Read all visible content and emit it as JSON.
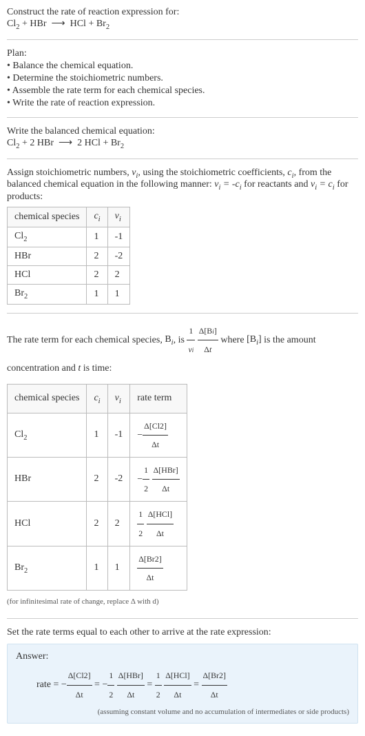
{
  "intro": {
    "line1": "Construct the rate of reaction expression for:",
    "arrow": "⟶"
  },
  "plan": {
    "title": "Plan:",
    "items": [
      "• Balance the chemical equation.",
      "• Determine the stoichiometric numbers.",
      "• Assemble the rate term for each chemical species.",
      "• Write the rate of reaction expression."
    ]
  },
  "balanced": {
    "title": "Write the balanced chemical equation:"
  },
  "stoich": {
    "text1": "Assign stoichiometric numbers, ",
    "text2": ", using the stoichiometric coefficients, ",
    "text3": ", from the balanced chemical equation in the following manner: ",
    "text4": " for reactants and ",
    "text5": " for products:",
    "headers": {
      "species": "chemical species",
      "ci": "cᵢ",
      "vi": "νᵢ"
    },
    "rows": [
      {
        "sp": "Cl₂",
        "ci": "1",
        "vi": "-1"
      },
      {
        "sp": "HBr",
        "ci": "2",
        "vi": "-2"
      },
      {
        "sp": "HCl",
        "ci": "2",
        "vi": "2"
      },
      {
        "sp": "Br₂",
        "ci": "1",
        "vi": "1"
      }
    ]
  },
  "rateterm": {
    "text1": "The rate term for each chemical species, ",
    "text2": ", is ",
    "text3": " where ",
    "text4": " is the amount concentration and ",
    "text5": " is time:",
    "headers": {
      "species": "chemical species",
      "ci": "cᵢ",
      "vi": "νᵢ",
      "rate": "rate term"
    },
    "rows": [
      {
        "sp": "Cl₂",
        "ci": "1",
        "vi": "-1",
        "num": "Δ[Cl2]",
        "den": "Δt",
        "pre": "−",
        "half": ""
      },
      {
        "sp": "HBr",
        "ci": "2",
        "vi": "-2",
        "num": "Δ[HBr]",
        "den": "Δt",
        "pre": "−",
        "half": "½"
      },
      {
        "sp": "HCl",
        "ci": "2",
        "vi": "2",
        "num": "Δ[HCl]",
        "den": "Δt",
        "pre": "",
        "half": "½"
      },
      {
        "sp": "Br₂",
        "ci": "1",
        "vi": "1",
        "num": "Δ[Br2]",
        "den": "Δt",
        "pre": "",
        "half": ""
      }
    ],
    "note": "(for infinitesimal rate of change, replace Δ with d)"
  },
  "final": {
    "title": "Set the rate terms equal to each other to arrive at the rate expression:"
  },
  "answer": {
    "label": "Answer:",
    "prefix": "rate = ",
    "eq": " = ",
    "neg": "−",
    "half_num": "1",
    "half_den": "2",
    "t1_num": "Δ[Cl2]",
    "t1_den": "Δt",
    "t2_num": "Δ[HBr]",
    "t2_den": "Δt",
    "t3_num": "Δ[HCl]",
    "t3_den": "Δt",
    "t4_num": "Δ[Br2]",
    "t4_den": "Δt",
    "note": "(assuming constant volume and no accumulation of intermediates or side products)"
  },
  "chem": {
    "Cl2": "Cl",
    "Cl2_sub": "2",
    "HBr": "HBr",
    "HCl": "HCl",
    "Br2": "Br",
    "Br2_sub": "2",
    "plus": " + ",
    "two": "2 "
  }
}
